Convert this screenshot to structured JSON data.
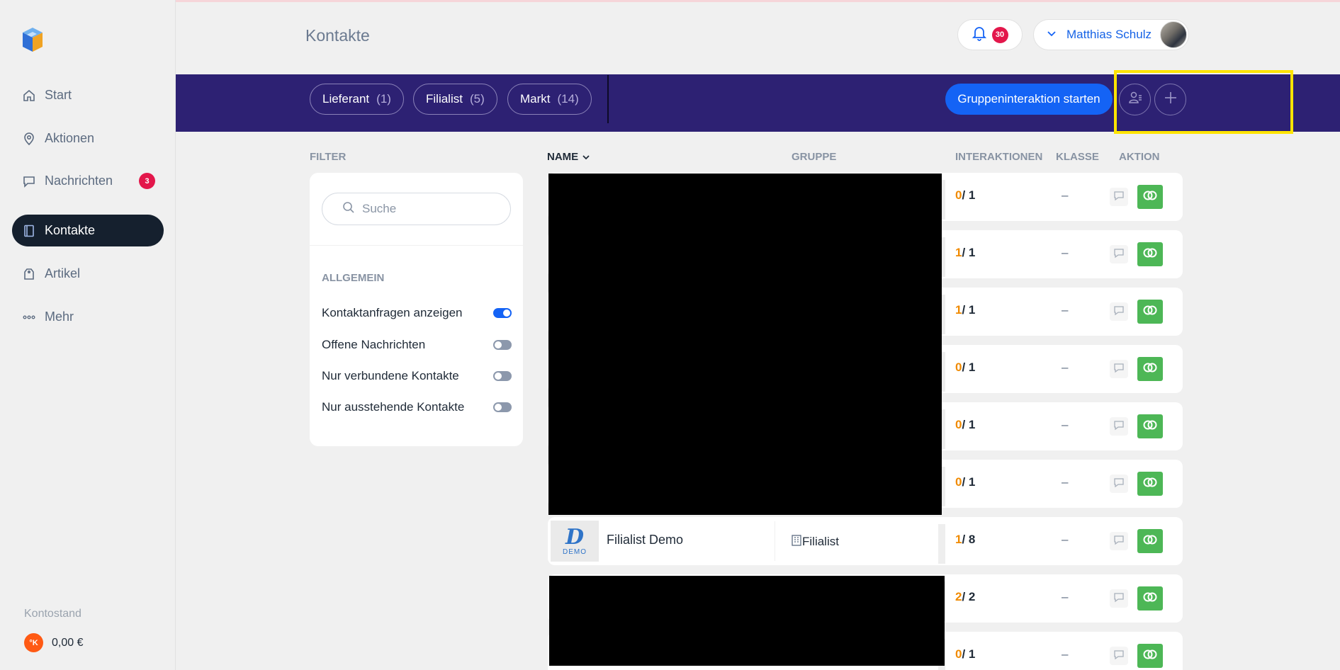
{
  "app": {
    "page_title": "Kontakte",
    "notifications_count": "30",
    "user_name": "Matthias Schulz"
  },
  "sidebar": {
    "items": [
      {
        "label": "Start",
        "icon": "home-icon"
      },
      {
        "label": "Aktionen",
        "icon": "map-pin-icon"
      },
      {
        "label": "Nachrichten",
        "icon": "chat-icon",
        "badge": "3"
      },
      {
        "label": "Kontakte",
        "icon": "book-icon",
        "active": true
      },
      {
        "label": "Artikel",
        "icon": "tag-icon"
      },
      {
        "label": "Mehr",
        "icon": "more-dots-icon"
      }
    ],
    "balance_label": "Kontostand",
    "balance_coin": "°K",
    "balance_value": "0,00 €"
  },
  "banner": {
    "chips": [
      {
        "label": "Lieferant",
        "count": "(1)"
      },
      {
        "label": "Filialist",
        "count": "(5)"
      },
      {
        "label": "Markt",
        "count": "(14)"
      }
    ],
    "primary_button": "Gruppeninteraktion starten"
  },
  "filter": {
    "title": "FILTER",
    "search_placeholder": "Suche",
    "section": "ALLGEMEIN",
    "toggles": [
      {
        "label": "Kontaktanfragen anzeigen",
        "on": true
      },
      {
        "label": "Offene Nachrichten",
        "on": false
      },
      {
        "label": "Nur verbundene Kontakte",
        "on": false
      },
      {
        "label": "Nur ausstehende Kontakte",
        "on": false
      }
    ]
  },
  "table": {
    "headers": {
      "name": "NAME",
      "group": "GRUPPE",
      "interactions": "INTERAKTIONEN",
      "class": "KLASSE",
      "action": "AKTION"
    },
    "rows": [
      {
        "done": "0",
        "total": "/ 1",
        "klasse": "–"
      },
      {
        "done": "1",
        "total": "/ 1",
        "klasse": "–"
      },
      {
        "done": "1",
        "total": "/ 1",
        "klasse": "–"
      },
      {
        "done": "0",
        "total": "/ 1",
        "klasse": "–"
      },
      {
        "done": "0",
        "total": "/ 1",
        "klasse": "–"
      },
      {
        "done": "0",
        "total": "/ 1",
        "klasse": "–"
      },
      {
        "done": "1",
        "total": "/ 8",
        "klasse": "–",
        "name": "Filialist Demo",
        "group": "Filialist",
        "logo_d": "D",
        "logo_text": "DEMO"
      },
      {
        "done": "2",
        "total": "/ 2",
        "klasse": "–"
      },
      {
        "done": "0",
        "total": "/ 1",
        "klasse": "–"
      }
    ]
  },
  "colors": {
    "banner": "#2d2173",
    "primary": "#1463f5",
    "accent_orange": "#f08a00",
    "connect_green": "#4db756",
    "badge_red": "#e3174b",
    "highlight": "#ffe400"
  }
}
